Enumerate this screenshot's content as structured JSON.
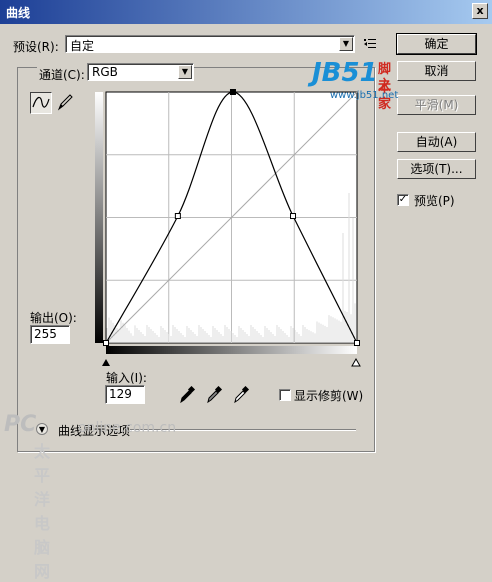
{
  "window": {
    "title": "曲线",
    "close_glyph": "x"
  },
  "preset": {
    "label": "预设(R):",
    "value": "自定"
  },
  "channel": {
    "label": "通道(C):",
    "value": "RGB"
  },
  "buttons": {
    "ok": "确定",
    "cancel": "取消",
    "smooth": "平滑(M)",
    "auto": "自动(A)",
    "options": "选项(T)..."
  },
  "preview": {
    "label": "预览(P)",
    "checked": true,
    "check_glyph": "✓"
  },
  "output": {
    "label": "输出(O):",
    "value": "255"
  },
  "input": {
    "label": "输入(I):",
    "value": "129"
  },
  "clipping": {
    "label": "显示修剪(W)",
    "checked": false
  },
  "display_options": {
    "label": "曲线显示选项"
  },
  "watermarks": {
    "top_brand": "JB51",
    "top_cn_1": "脚本",
    "top_cn_2": "之家",
    "top_url": "www.jb51.net",
    "bottom_brand": "PC",
    "bottom_url": "online.com.cn",
    "bottom_cn": "太平洋电脑网"
  },
  "chart_data": {
    "type": "line",
    "xlim": [
      0,
      255
    ],
    "ylim": [
      0,
      255
    ],
    "grid": true,
    "series": [
      {
        "points": [
          [
            0,
            0
          ],
          [
            73,
            129
          ],
          [
            129,
            255
          ],
          [
            190,
            129
          ],
          [
            255,
            0
          ]
        ]
      },
      {
        "points": [
          [
            0,
            0
          ],
          [
            255,
            255
          ]
        ]
      }
    ]
  }
}
